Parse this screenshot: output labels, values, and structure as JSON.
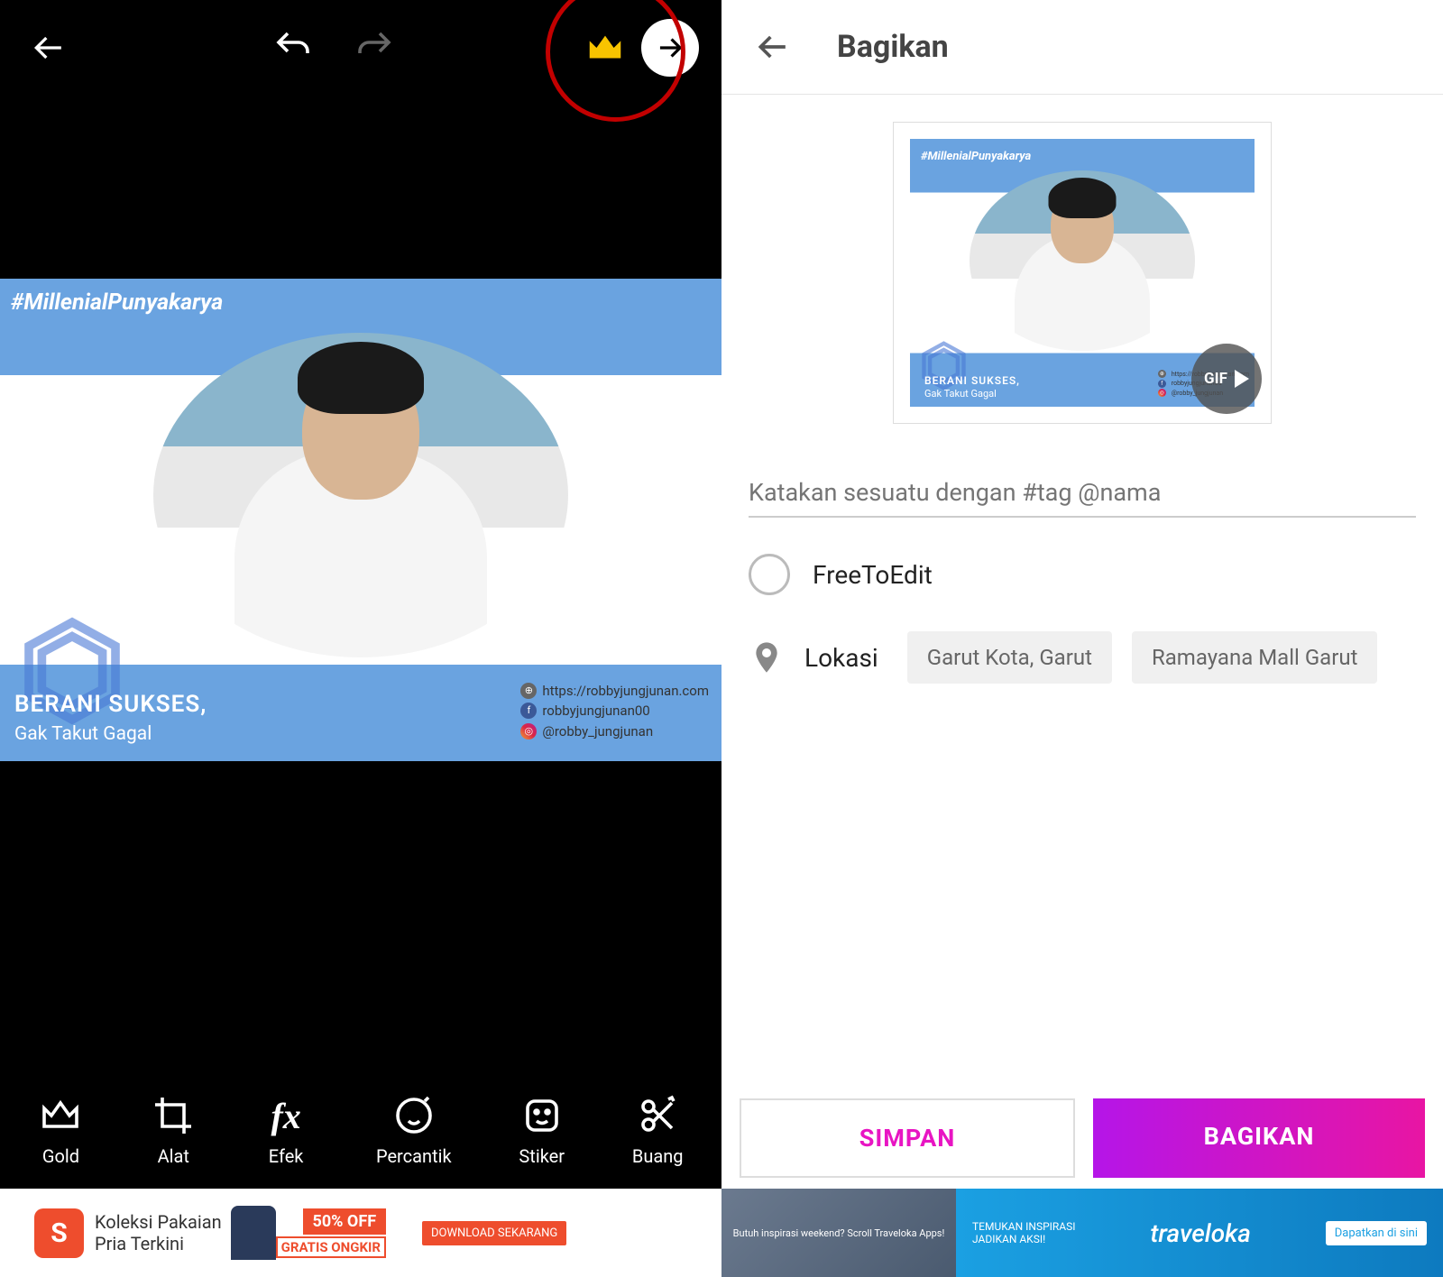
{
  "editor": {
    "canvas": {
      "hashtag": "#MillenialPunyakarya",
      "headline": "BERANI SUKSES,",
      "subhead": "Gak Takut Gagal",
      "socials": {
        "website": "https://robbyjungjunan.com",
        "facebook": "robbyjungjunan00",
        "instagram": "@robby_jungjunan"
      }
    },
    "tools": [
      {
        "id": "gold",
        "label": "Gold"
      },
      {
        "id": "alat",
        "label": "Alat"
      },
      {
        "id": "efek",
        "label": "Efek"
      },
      {
        "id": "percantik",
        "label": "Percantik"
      },
      {
        "id": "stiker",
        "label": "Stiker"
      },
      {
        "id": "buang",
        "label": "Buang"
      }
    ],
    "ad": {
      "brand_letter": "S",
      "text_line1": "Koleksi Pakaian",
      "text_line2": "Pria Terkini",
      "off": "50% OFF",
      "gratis": "GRATIS ONGKIR",
      "download": "DOWNLOAD SEKARANG"
    }
  },
  "share": {
    "title": "Bagikan",
    "gif_label": "GIF",
    "caption_placeholder": "Katakan sesuatu dengan #tag @nama",
    "free_to_edit": "FreeToEdit",
    "location_label": "Lokasi",
    "location_chips": [
      "Garut Kota, Garut",
      "Ramayana Mall Garut"
    ],
    "save_btn": "SIMPAN",
    "share_btn": "BAGIKAN",
    "ad": {
      "left_text": "Butuh inspirasi weekend? Scroll Traveloka Apps!",
      "tagline1": "TEMUKAN INSPIRASI",
      "tagline2": "JADIKAN AKSI!",
      "brand": "traveloka",
      "cta": "Dapatkan di sini"
    }
  }
}
